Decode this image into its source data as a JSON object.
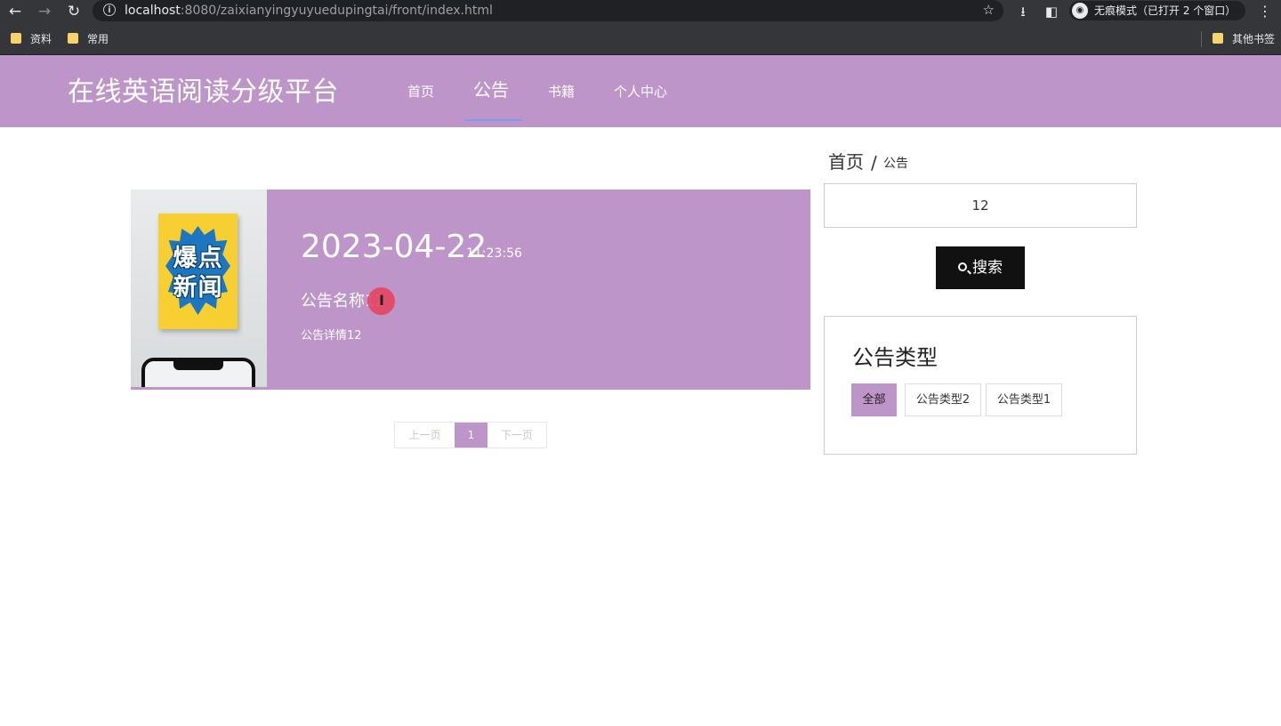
{
  "browser": {
    "url_host": "localhost",
    "url_rest": ":8080/zaixianyingyuyuedupingtai/front/index.html",
    "incognito_label": "无痕模式（已打开 2 个窗口）",
    "bookmarks": [
      "资料",
      "常用"
    ],
    "other_bookmarks": "其他书签"
  },
  "header": {
    "logo": "在线英语阅读分级平台",
    "nav": [
      "首页",
      "公告",
      "书籍",
      "个人中心"
    ],
    "active_index": 1,
    "colors": {
      "primary": "#bd95c8",
      "underline": "#7c9ee8"
    }
  },
  "news": {
    "date": "2023-04-22",
    "time": "11:23:56",
    "title": "公告名称12",
    "detail": "公告详情12",
    "poster_text": [
      "爆点",
      "新闻"
    ]
  },
  "pagination": {
    "prev": "上一页",
    "current": "1",
    "next": "下一页"
  },
  "sidebar": {
    "breadcrumb_home": "首页",
    "breadcrumb_sep": "/",
    "breadcrumb_current": "公告",
    "search_value": "12",
    "search_button": "搜索",
    "type_title": "公告类型",
    "types": [
      "全部",
      "公告类型2",
      "公告类型1"
    ],
    "active_type": 0
  }
}
